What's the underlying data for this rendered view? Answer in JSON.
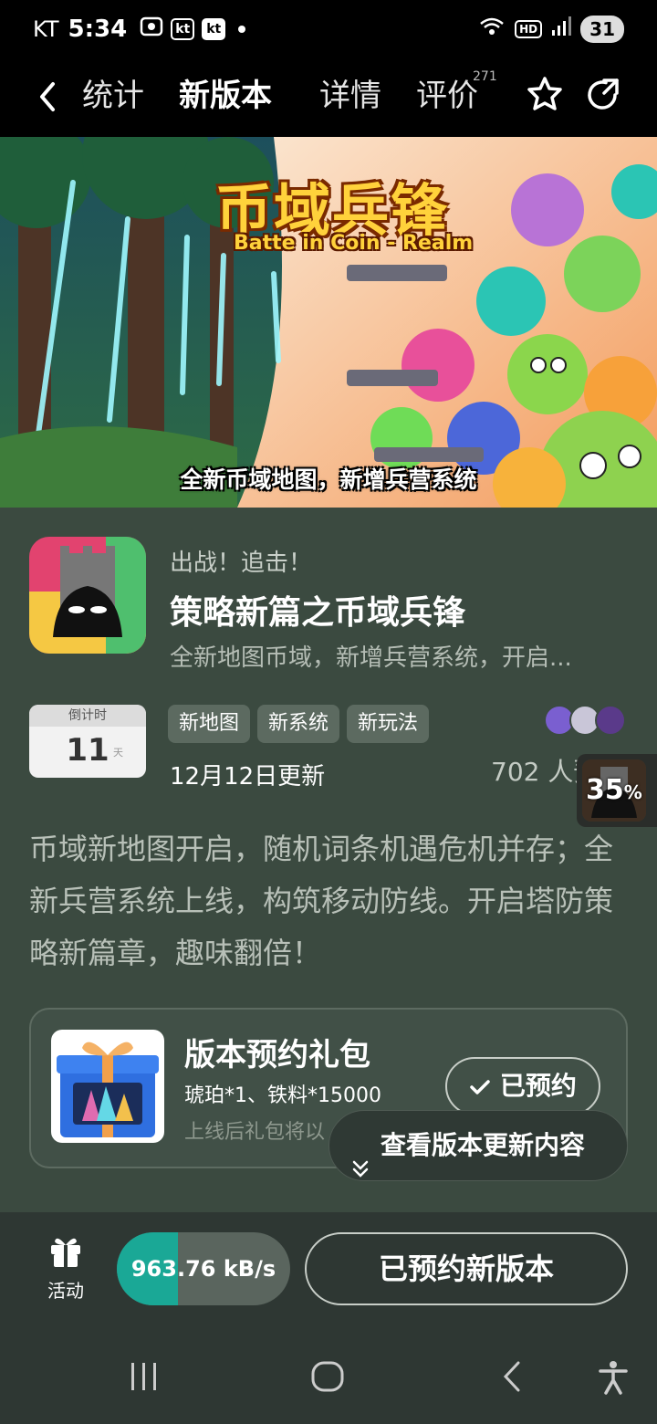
{
  "status_bar": {
    "carrier": "KT",
    "time": "5:34",
    "kt_icon_1": "kt",
    "kt_icon_2": "kt",
    "hd": "HD",
    "battery": "31"
  },
  "nav": {
    "tabs": [
      "统计",
      "新版本",
      "详情",
      "评价"
    ],
    "active_tab": "新版本",
    "review_count": "271",
    "icons": [
      "back-arrow-icon",
      "star-icon",
      "share-icon"
    ]
  },
  "banner": {
    "title_cn": "币域兵锋",
    "title_en": "Batte in Coin - Realm",
    "caption": "全新币域地图，新增兵营系统"
  },
  "app": {
    "tagline": "出战！追击！",
    "title": "策略新篇之币域兵锋",
    "subtitle": "全新地图币域，新增兵营系统，开启..."
  },
  "countdown": {
    "label": "倒计时",
    "number": "11",
    "unit": "天"
  },
  "tags": [
    "新地图",
    "新系统",
    "新玩法"
  ],
  "update_date": "12月12日更新",
  "reserve_count": "702 人预约",
  "floating_progress": {
    "value": "35",
    "unit": "%"
  },
  "description": "币域新地图开启，随机词条机遇危机并存；全新兵营系统上线，构筑移动防线。开启塔防策略新篇章，趣味翻倍！",
  "gift": {
    "title": "版本预约礼包",
    "items": "琥珀*1、铁料*15000",
    "note": "上线后礼包将以",
    "button": "已预约"
  },
  "update_pill": "查看版本更新内容",
  "action_bar": {
    "activity_label": "活动",
    "speed": "963.76 kB/s",
    "speed_progress": 0.35,
    "main_button": "已预约新版本"
  },
  "colors": {
    "accent": "#1aa896",
    "panel": "#3b4a40",
    "bar": "#2e3733"
  }
}
